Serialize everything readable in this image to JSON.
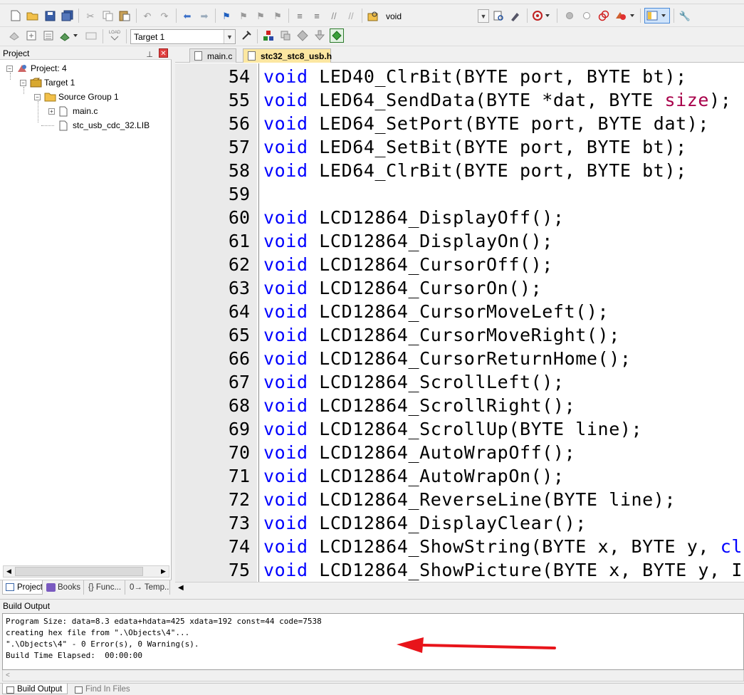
{
  "toolbar1": {
    "find_combo_value": "void"
  },
  "toolbar2": {
    "target_combo_value": "Target 1",
    "load_icon_label": "LOAD"
  },
  "project_panel": {
    "title": "Project",
    "tree": {
      "root": "Project: 4",
      "target": "Target 1",
      "group": "Source Group 1",
      "files": [
        "main.c",
        "stc_usb_cdc_32.LIB"
      ]
    },
    "tabs": [
      "Project",
      "Books",
      "{} Func...",
      "0→ Temp..."
    ]
  },
  "editor": {
    "tabs": [
      "main.c",
      "stc32_stc8_usb.h"
    ],
    "active_tab": "stc32_stc8_usb.h",
    "lines": [
      {
        "n": "54",
        "kw": "void",
        "rest": " LED40_ClrBit(BYTE port, BYTE bt);"
      },
      {
        "n": "55",
        "kw": "void",
        "rest": " LED64_SendData(BYTE *dat, BYTE ",
        "pm": "size",
        "tail": ");"
      },
      {
        "n": "56",
        "kw": "void",
        "rest": " LED64_SetPort(BYTE port, BYTE dat);"
      },
      {
        "n": "57",
        "kw": "void",
        "rest": " LED64_SetBit(BYTE port, BYTE bt);"
      },
      {
        "n": "58",
        "kw": "void",
        "rest": " LED64_ClrBit(BYTE port, BYTE bt);"
      },
      {
        "n": "59",
        "kw": "",
        "rest": ""
      },
      {
        "n": "60",
        "kw": "void",
        "rest": " LCD12864_DisplayOff();"
      },
      {
        "n": "61",
        "kw": "void",
        "rest": " LCD12864_DisplayOn();"
      },
      {
        "n": "62",
        "kw": "void",
        "rest": " LCD12864_CursorOff();"
      },
      {
        "n": "63",
        "kw": "void",
        "rest": " LCD12864_CursorOn();"
      },
      {
        "n": "64",
        "kw": "void",
        "rest": " LCD12864_CursorMoveLeft();"
      },
      {
        "n": "65",
        "kw": "void",
        "rest": " LCD12864_CursorMoveRight();"
      },
      {
        "n": "66",
        "kw": "void",
        "rest": " LCD12864_CursorReturnHome();"
      },
      {
        "n": "67",
        "kw": "void",
        "rest": " LCD12864_ScrollLeft();"
      },
      {
        "n": "68",
        "kw": "void",
        "rest": " LCD12864_ScrollRight();"
      },
      {
        "n": "69",
        "kw": "void",
        "rest": " LCD12864_ScrollUp(BYTE line);"
      },
      {
        "n": "70",
        "kw": "void",
        "rest": " LCD12864_AutoWrapOff();"
      },
      {
        "n": "71",
        "kw": "void",
        "rest": " LCD12864_AutoWrapOn();"
      },
      {
        "n": "72",
        "kw": "void",
        "rest": " LCD12864_ReverseLine(BYTE line);"
      },
      {
        "n": "73",
        "kw": "void",
        "rest": " LCD12864_DisplayClear();"
      },
      {
        "n": "74",
        "kw": "void",
        "rest": " LCD12864_ShowString(BYTE x, BYTE y, ",
        "kw2": "cl"
      },
      {
        "n": "75",
        "kw": "void",
        "rest": " LCD12864_ShowPicture(BYTE x, BYTE y, I"
      }
    ]
  },
  "build_output": {
    "title": "Build Output",
    "lines": [
      "Program Size: data=8.3 edata+hdata=425 xdata=192 const=44 code=7538",
      "creating hex file from \".\\Objects\\4\"...",
      "\".\\Objects\\4\" - 0 Error(s), 0 Warning(s).",
      "Build Time Elapsed:  00:00:00"
    ],
    "tabs": [
      "Build Output",
      "Find In Files"
    ]
  },
  "colors": {
    "keyword": "#0000ff",
    "param": "#a8004a",
    "active_tab_bg": "#fce7a1",
    "arrow": "#e8141a"
  }
}
